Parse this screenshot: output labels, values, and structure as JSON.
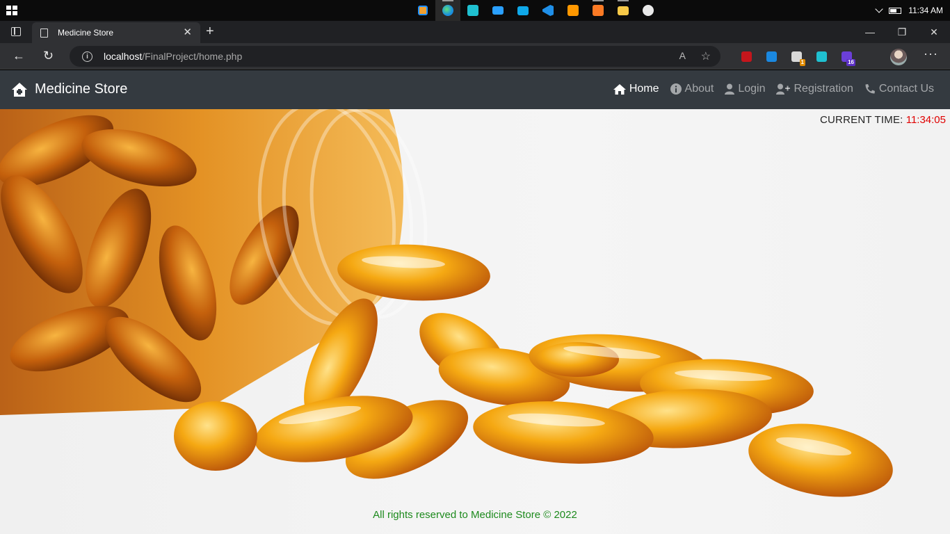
{
  "taskbar": {
    "time": "11:34 AM",
    "apps": [
      "task-view-icon",
      "edge-icon",
      "remote-desktop-icon",
      "screen-icon",
      "mail-icon",
      "vscode-icon",
      "sublime-icon",
      "xampp-icon",
      "file-explorer-icon",
      "paint-icon"
    ]
  },
  "browser": {
    "tab_title": "Medicine Store",
    "url_host": "localhost",
    "url_path": "/FinalProject/home.php",
    "extensions": [
      {
        "name": "ublock-icon",
        "color": "#c4161c",
        "badge": ""
      },
      {
        "name": "s-extension-icon",
        "color": "#1a88e0",
        "badge": ""
      },
      {
        "name": "cloud-extension-icon",
        "color": "#d9d9d9",
        "badge": "1"
      },
      {
        "name": "remote-extension-icon",
        "color": "#1fc0d0",
        "badge": ""
      },
      {
        "name": "purple-extension-icon",
        "color": "#6b3fd8",
        "badge": "16"
      }
    ]
  },
  "site": {
    "brand": "Medicine Store",
    "nav": [
      {
        "label": "Home",
        "icon": "home-icon",
        "active": true
      },
      {
        "label": "About",
        "icon": "info-icon",
        "active": false
      },
      {
        "label": "Login",
        "icon": "user-icon",
        "active": false
      },
      {
        "label": "Registration",
        "icon": "user-plus-icon",
        "active": false
      },
      {
        "label": "Contact Us",
        "icon": "phone-icon",
        "active": false
      }
    ],
    "clock_label": "CURRENT TIME:",
    "clock_value": "11:34:05",
    "footer": "All rights reserved to Medicine Store © 2022"
  },
  "colors": {
    "navbar": "#343a40",
    "clock_value": "#e00000",
    "footer_text": "#1d8a1d",
    "capsule": "#f2a20c"
  }
}
